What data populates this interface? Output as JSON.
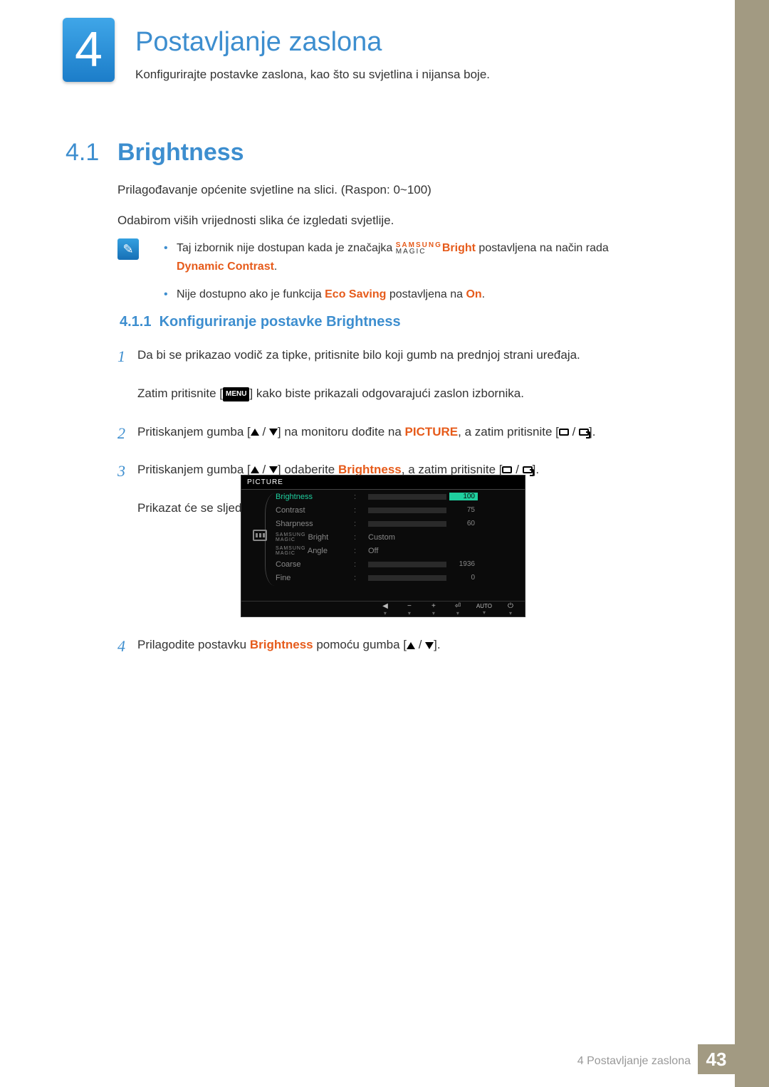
{
  "chapter": {
    "number": "4",
    "title": "Postavljanje zaslona",
    "description": "Konfigurirajte postavke zaslona, kao što su svjetlina i nijansa boje."
  },
  "section": {
    "number": "4.1",
    "title": "Brightness",
    "p1": "Prilagođavanje općenite svjetline na slici. (Raspon: 0~100)",
    "p2": "Odabirom viših vrijednosti slika će izgledati svjetlije."
  },
  "notes": {
    "n1_a": "Taj izbornik nije dostupan kada je značajka ",
    "magic_top": "SAMSUNG",
    "magic_bottom": "MAGIC",
    "n1_b": "Bright",
    "n1_c": " postavljena na način rada ",
    "n1_d": "Dynamic Contrast",
    "n1_e": ".",
    "n2_a": "Nije dostupno ako je funkcija ",
    "n2_b": "Eco Saving",
    "n2_c": " postavljena na ",
    "n2_d": "On",
    "n2_e": "."
  },
  "subsection": {
    "number": "4.1.1",
    "title": "Konfiguriranje postavke Brightness"
  },
  "steps": {
    "s1_num": "1",
    "s1_a": "Da bi se prikazao vodič za tipke, pritisnite bilo koji gumb na prednjoj strani uređaja.",
    "s1_b_a": "Zatim pritisnite [",
    "s1_b_menu": "MENU",
    "s1_b_b": "] kako biste prikazali odgovarajući zaslon izbornika.",
    "s2_num": "2",
    "s2_a": "Pritiskanjem gumba [",
    "s2_b": "] na monitoru dođite na ",
    "s2_picture": "PICTURE",
    "s2_c": ", a zatim pritisnite [",
    "s2_d": "].",
    "s3_num": "3",
    "s3_a": "Pritiskanjem gumba [",
    "s3_b": "] odaberite ",
    "s3_brightness": "Brightness",
    "s3_c": ", a zatim pritisnite [",
    "s3_d": "].",
    "s3_e": "Prikazat će se sljedeći zaslon.",
    "s4_num": "4",
    "s4_a": "Prilagodite postavku ",
    "s4_brightness": "Brightness",
    "s4_b": " pomoću gumba [",
    "s4_c": "]."
  },
  "osd": {
    "title": "PICTURE",
    "rows": [
      {
        "label": "Brightness",
        "value": "100",
        "bar": 100,
        "highlighted": true
      },
      {
        "label": "Contrast",
        "value": "75",
        "bar": 75
      },
      {
        "label": "Sharpness",
        "value": "60",
        "bar": 60
      },
      {
        "label_prefix": "MAGIC",
        "label_suffix": " Bright",
        "text": "Custom"
      },
      {
        "label_prefix": "MAGIC",
        "label_suffix": " Angle",
        "text": "Off"
      },
      {
        "label": "Coarse",
        "value": "1936",
        "bar": 70
      },
      {
        "label": "Fine",
        "value": "0",
        "bar": 0
      }
    ],
    "footer_auto": "AUTO"
  },
  "footer": {
    "text": "4 Postavljanje zaslona",
    "page": "43"
  }
}
